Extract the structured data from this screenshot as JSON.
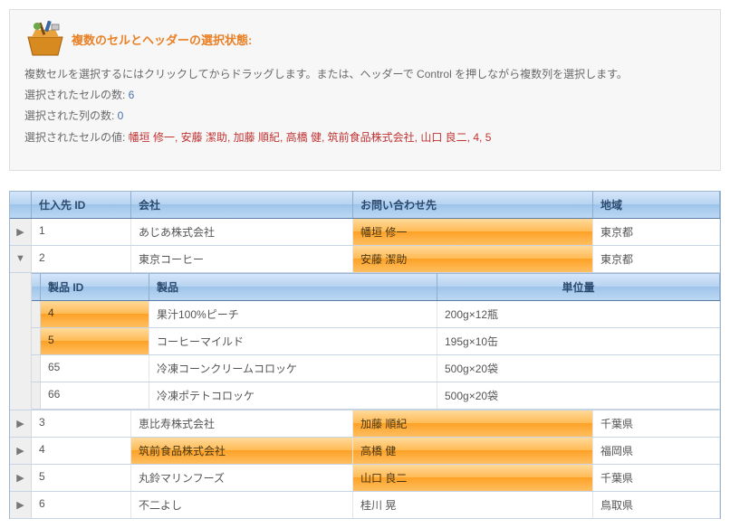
{
  "panel": {
    "title": "複数のセルとヘッダーの選択状態:",
    "help": "複数セルを選択するにはクリックしてからドラッグします。または、ヘッダーで Control を押しながら複数列を選択します。",
    "cells_label": "選択されたセルの数: ",
    "cells_value": "6",
    "cols_label": "選択された列の数: ",
    "cols_value": "0",
    "vals_label": "選択されたセルの値: ",
    "vals_value": "幡垣 修一, 安藤 潔助, 加藤 順紀, 高橋 健, 筑前食品株式会社, 山口 良二, 4, 5"
  },
  "grid": {
    "header": {
      "id": "仕入先 ID",
      "company": "会社",
      "contact": "お問い合わせ先",
      "region": "地域"
    },
    "rows": [
      {
        "exp": "▶",
        "id": "1",
        "company": "あじあ株式会社",
        "contact": "幡垣 修一",
        "region": "東京都",
        "sel": {
          "contact": true
        }
      },
      {
        "exp": "▼",
        "id": "2",
        "company": "東京コーヒー",
        "contact": "安藤 潔助",
        "region": "東京都",
        "sel": {
          "contact": true
        }
      },
      {
        "exp": "▶",
        "id": "3",
        "company": "恵比寿株式会社",
        "contact": "加藤 順紀",
        "region": "千葉県",
        "sel": {
          "contact": true
        }
      },
      {
        "exp": "▶",
        "id": "4",
        "company": "筑前食品株式会社",
        "contact": "高橋 健",
        "region": "福岡県",
        "sel": {
          "company": true,
          "contact": true
        }
      },
      {
        "exp": "▶",
        "id": "5",
        "company": "丸鈴マリンフーズ",
        "contact": "山口 良二",
        "region": "千葉県",
        "sel": {
          "contact": true
        }
      },
      {
        "exp": "▶",
        "id": "6",
        "company": "不二よし",
        "contact": "桂川 晃",
        "region": "鳥取県"
      }
    ]
  },
  "nested": {
    "header": {
      "id": "製品 ID",
      "product": "製品",
      "unit": "単位量"
    },
    "rows": [
      {
        "id": "4",
        "product": "果汁100%ピーチ",
        "unit": "200g×12瓶",
        "sel": {
          "id": true
        }
      },
      {
        "id": "5",
        "product": "コーヒーマイルド",
        "unit": "195g×10缶",
        "sel": {
          "id": true
        }
      },
      {
        "id": "65",
        "product": "冷凍コーンクリームコロッケ",
        "unit": "500g×20袋"
      },
      {
        "id": "66",
        "product": "冷凍ポテトコロッケ",
        "unit": "500g×20袋"
      }
    ]
  }
}
